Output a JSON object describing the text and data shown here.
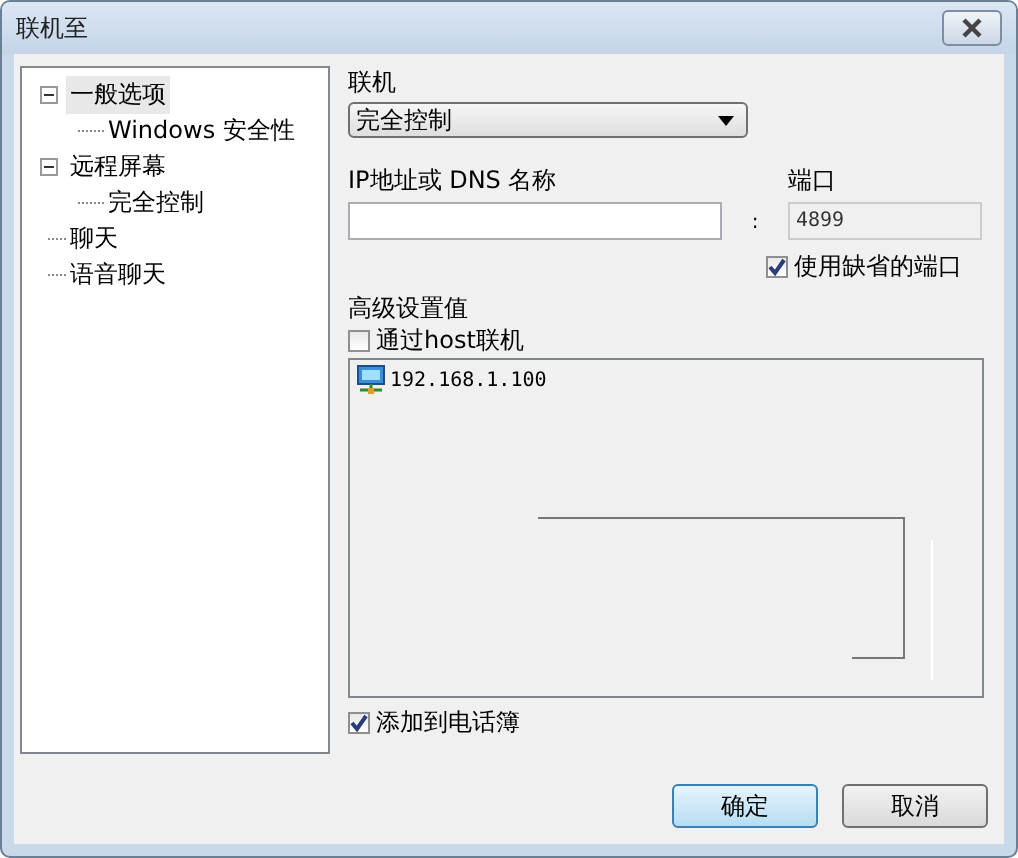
{
  "window": {
    "title": "联机至"
  },
  "tree": [
    {
      "label": "一般选项",
      "selected": true,
      "expanded": true,
      "children": [
        {
          "label": "Windows 安全性",
          "selected": false
        }
      ]
    },
    {
      "label": "远程屏幕",
      "selected": false,
      "expanded": true,
      "children": [
        {
          "label": "完全控制",
          "selected": false
        }
      ]
    },
    {
      "label": "聊天",
      "selected": false
    },
    {
      "label": "语音聊天",
      "selected": false
    }
  ],
  "connection": {
    "label": "联机",
    "value": "完全控制"
  },
  "address": {
    "label": "IP地址或 DNS 名称"
  },
  "port": {
    "label": "端口",
    "separator": ":",
    "value": "4899",
    "disabled": true
  },
  "use_default_port": {
    "label": "使用缺省的端口",
    "checked": true
  },
  "advanced": {
    "label": "高级设置值"
  },
  "via_host": {
    "label": "通过host联机",
    "checked": false
  },
  "hosts": [
    {
      "label": "192.168.1.100"
    }
  ],
  "add_to_phonebook": {
    "label": "添加到电话簿",
    "checked": true
  },
  "buttons": [
    {
      "label": "确定",
      "kind": "default"
    },
    {
      "label": "取消",
      "kind": "normal"
    }
  ]
}
